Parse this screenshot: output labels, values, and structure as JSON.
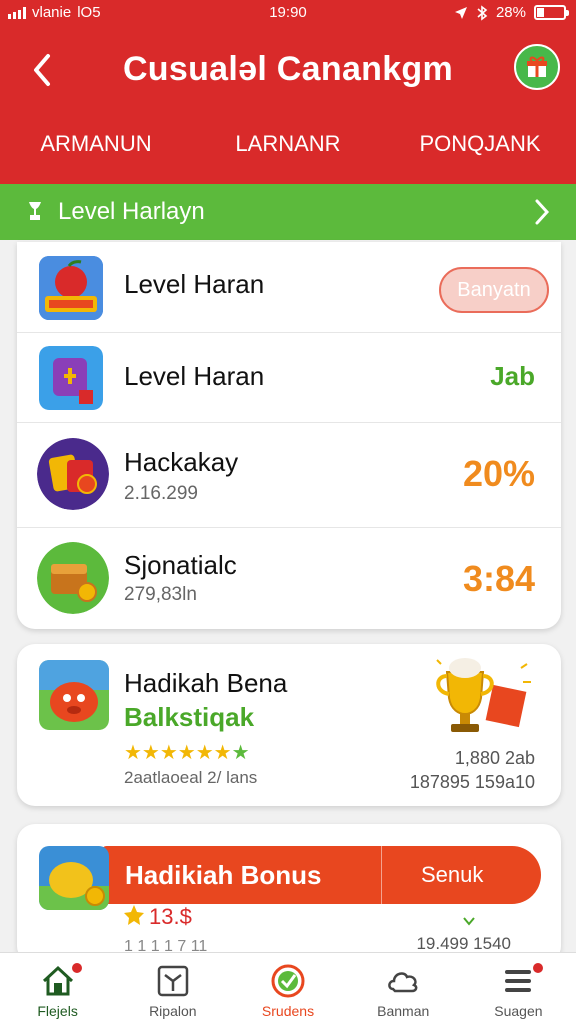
{
  "status_bar": {
    "carrier": "vlanie",
    "network": "lO5",
    "time": "19:90",
    "battery": "28%"
  },
  "header": {
    "title": "Cusualəl Canankgm"
  },
  "tabs": [
    {
      "label": "ARMANUN",
      "active": true
    },
    {
      "label": "LARNANR",
      "active": false
    },
    {
      "label": "PONQJANK",
      "active": false
    }
  ],
  "level_bar": {
    "label": "Level Harlayn"
  },
  "list": {
    "rows": [
      {
        "title": "Level Haran",
        "action_label": "Banyatn"
      },
      {
        "title": "Level Haran",
        "value": "Jab"
      },
      {
        "title": "Hackakay",
        "subtitle": "2.16.299",
        "value": "20%"
      },
      {
        "title": "Sjonatialc",
        "subtitle": "279,83ln",
        "value": "3:84"
      }
    ]
  },
  "bonus_card": {
    "title": "Hadikah Bena",
    "subtitle": "Balkstiqak",
    "stars_filled": 6,
    "stars_total": 7,
    "caption": "2aatlaoeal 2/ lans",
    "stat_1": "1,880 2ab",
    "stat_2": "187895 159a10"
  },
  "bonus_card_2": {
    "banner_title": "Hadikiah Bonus",
    "banner_action": "Senuk",
    "amount": "13.$",
    "sub_left": "1 1 1 1 7 11",
    "sub_right": "19.499 1540"
  },
  "bottom_nav": [
    {
      "label": "Flejels",
      "icon": "home-icon"
    },
    {
      "label": "Ripalon",
      "icon": "grid-icon"
    },
    {
      "label": "Srudens",
      "icon": "check-circle-icon"
    },
    {
      "label": "Banman",
      "icon": "cloud-icon"
    },
    {
      "label": "Suagen",
      "icon": "menu-icon"
    }
  ],
  "colors": {
    "primary_red": "#d92a2a",
    "green": "#5cba3c",
    "orange": "#e8471f",
    "gold": "#f2b705"
  }
}
